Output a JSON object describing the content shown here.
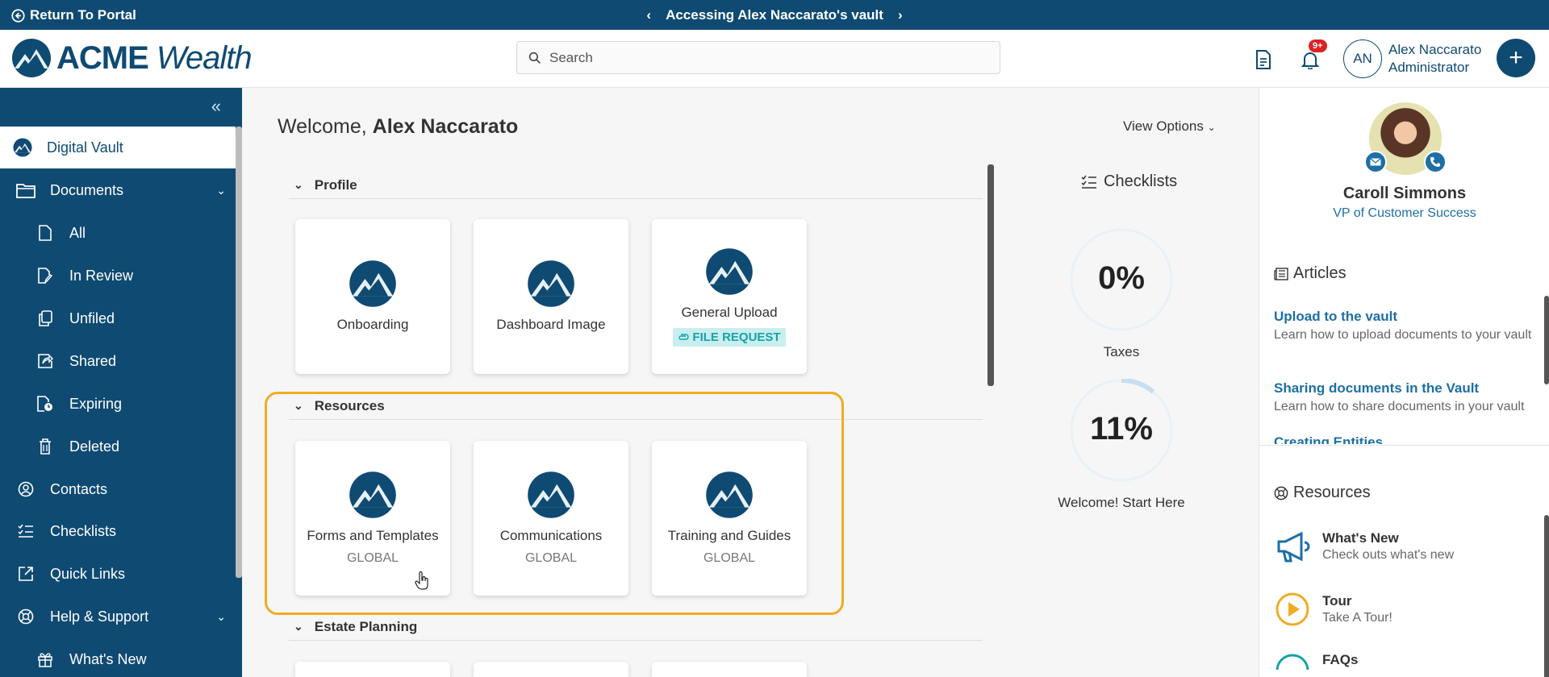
{
  "topbar": {
    "return_label": "Return To Portal",
    "vault_title": "Accessing Alex Naccarato's vault"
  },
  "header": {
    "logo_bold": "ACME",
    "logo_italic": " Wealth",
    "search_placeholder": "Search",
    "notification_badge": "9+",
    "avatar_initials": "AN",
    "user_name": "Alex Naccarato",
    "user_role": "Administrator"
  },
  "sidebar": {
    "items": [
      {
        "label": "Digital Vault"
      },
      {
        "label": "Documents"
      },
      {
        "label": "All"
      },
      {
        "label": "In Review"
      },
      {
        "label": "Unfiled"
      },
      {
        "label": "Shared"
      },
      {
        "label": "Expiring"
      },
      {
        "label": "Deleted"
      },
      {
        "label": "Contacts"
      },
      {
        "label": "Checklists"
      },
      {
        "label": "Quick Links"
      },
      {
        "label": "Help & Support"
      },
      {
        "label": "What's New"
      }
    ]
  },
  "main": {
    "welcome_prefix": "Welcome, ",
    "welcome_name": "Alex Naccarato",
    "view_options": "View Options",
    "sections": [
      {
        "title": "Profile",
        "cards": [
          {
            "label": "Onboarding"
          },
          {
            "label": "Dashboard Image"
          },
          {
            "label": "General Upload",
            "tag": "FILE REQUEST"
          }
        ]
      },
      {
        "title": "Resources",
        "cards": [
          {
            "label": "Forms and Templates",
            "sub": "GLOBAL"
          },
          {
            "label": "Communications",
            "sub": "GLOBAL"
          },
          {
            "label": "Training and Guides",
            "sub": "GLOBAL"
          }
        ]
      },
      {
        "title": "Estate Planning",
        "cards": []
      }
    ]
  },
  "checklists": {
    "title": "Checklists",
    "items": [
      {
        "value": "0%",
        "progress": 0,
        "label": "Taxes"
      },
      {
        "value": "11%",
        "progress": 0.11,
        "label": "Welcome! Start Here"
      }
    ]
  },
  "right_panel": {
    "agent_name": "Caroll Simmons",
    "agent_title": "VP of Customer Success",
    "articles_title": "Articles",
    "articles": [
      {
        "title": "Upload to the vault",
        "desc": "Learn how to upload documents to your vault"
      },
      {
        "title": "Sharing documents in the Vault",
        "desc": "Learn how to share documents in your vault"
      },
      {
        "title": "Creating Entities",
        "desc": ""
      }
    ],
    "resources_title": "Resources",
    "resources": [
      {
        "title": "What's New",
        "desc": "Check outs what's new",
        "icon": "megaphone-icon"
      },
      {
        "title": "Tour",
        "desc": "Take A Tour!",
        "icon": "play-circle-icon"
      },
      {
        "title": "FAQs",
        "desc": "",
        "icon": "faq-icon"
      }
    ]
  },
  "colors": {
    "brand": "#0f4a72",
    "accent_link": "#1d6fa5",
    "highlight": "#f0ac25",
    "file_request_bg": "#c8eef0",
    "file_request_fg": "#17a2a8",
    "badge": "#dd2222"
  }
}
